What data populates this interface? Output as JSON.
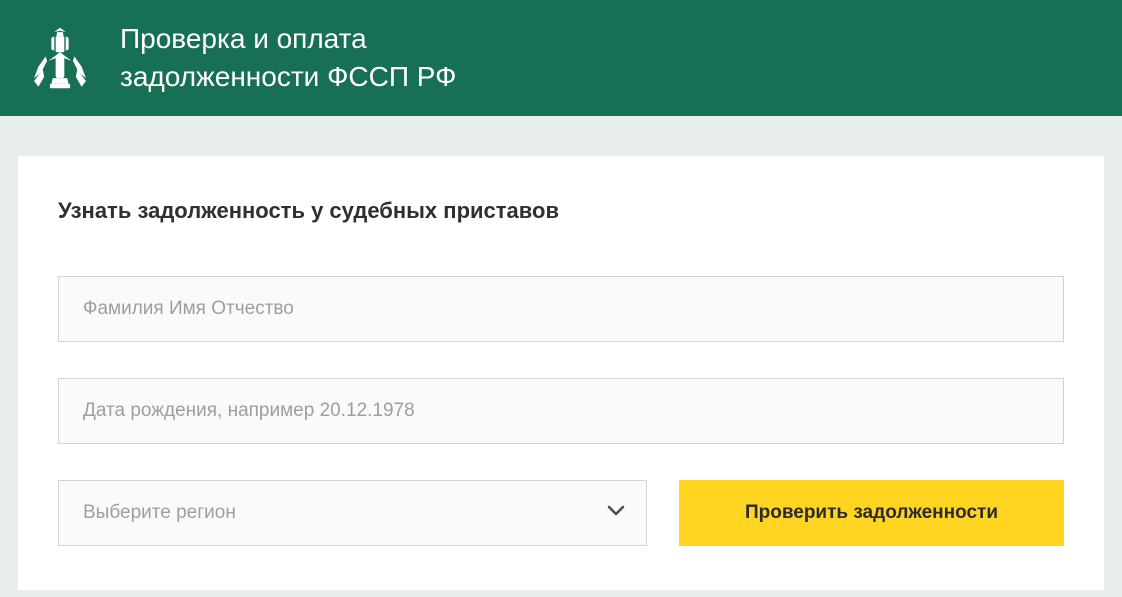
{
  "header": {
    "title_line1": "Проверка и оплата",
    "title_line2": "задолженности ФССП РФ"
  },
  "form": {
    "title": "Узнать задолженность у судебных приставов",
    "name_placeholder": "Фамилия Имя Отчество",
    "birthdate_placeholder": "Дата рождения, например 20.12.1978",
    "region_placeholder": "Выберите регион",
    "submit_label": "Проверить задолженности"
  }
}
